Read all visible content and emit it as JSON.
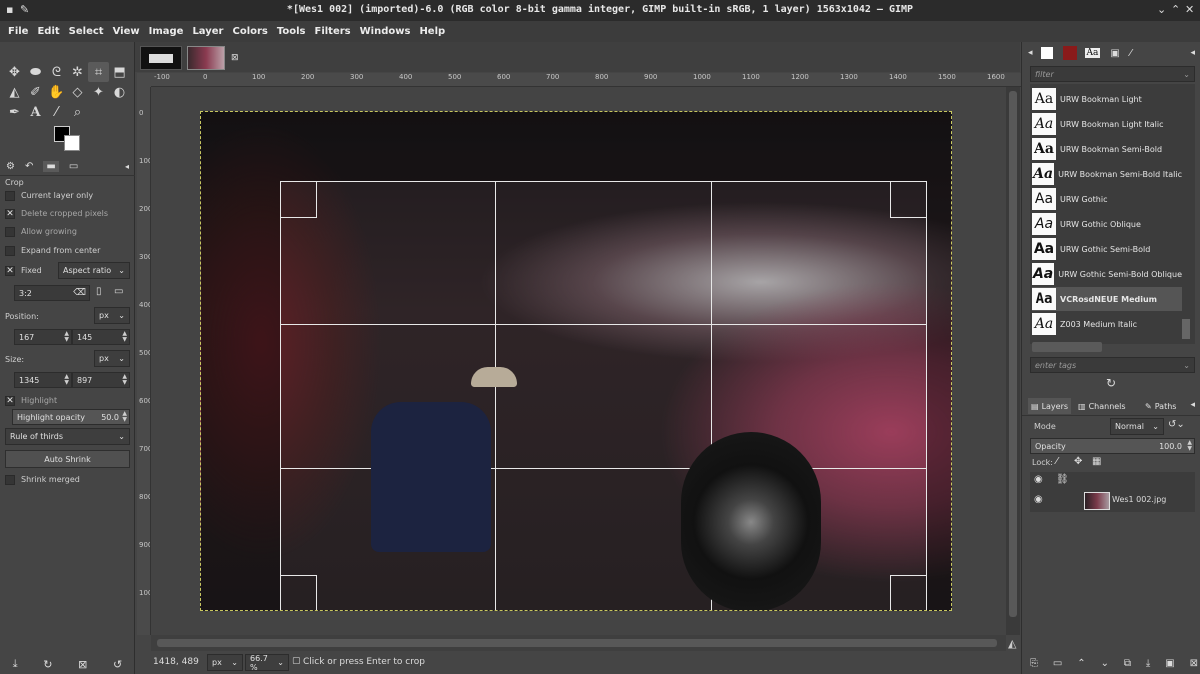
{
  "window": {
    "title": "*[Wes1 002] (imported)-6.0 (RGB color 8-bit gamma integer, GIMP built-in sRGB, 1 layer) 1563x1042 – GIMP",
    "minimize": "⌄",
    "maximize": "⌃",
    "close": "✕"
  },
  "menu": [
    "File",
    "Edit",
    "Select",
    "View",
    "Image",
    "Layer",
    "Colors",
    "Tools",
    "Filters",
    "Windows",
    "Help"
  ],
  "tool_options": {
    "section_title": "Crop",
    "current_layer_only": "Current layer only",
    "delete_cropped": "Delete cropped pixels",
    "allow_growing": "Allow growing",
    "expand_center": "Expand from center",
    "fixed": "Fixed",
    "aspect_ratio": "Aspect ratio",
    "ratio_value": "3:2",
    "position_label": "Position:",
    "position_unit": "px",
    "pos_x": "167",
    "pos_y": "145",
    "size_label": "Size:",
    "size_unit": "px",
    "size_w": "1345",
    "size_h": "897",
    "highlight": "Highlight",
    "highlight_opacity_label": "Highlight opacity",
    "highlight_opacity_value": "50.0",
    "guides": "Rule of thirds",
    "auto_shrink": "Auto Shrink",
    "shrink_merged": "Shrink merged"
  },
  "status": {
    "coords": "1418, 489",
    "unit": "px",
    "zoom": "66.7 %",
    "message": "Click or press Enter to crop"
  },
  "ruler_top": [
    "-100",
    "0",
    "100",
    "200",
    "300",
    "400",
    "500",
    "600",
    "700",
    "800",
    "900",
    "1000",
    "1100",
    "1200",
    "1300",
    "1400",
    "1500",
    "1600"
  ],
  "ruler_left": [
    "0",
    "100",
    "200",
    "300",
    "400",
    "500",
    "600",
    "700",
    "800",
    "900",
    "1000"
  ],
  "fonts": {
    "filter_placeholder": "filter",
    "tags_placeholder": "enter tags",
    "glyph": "Aa",
    "items": [
      "URW Bookman Light",
      "URW Bookman Light Italic",
      "URW Bookman Semi-Bold",
      "URW Bookman Semi-Bold Italic",
      "URW Gothic",
      "URW Gothic Oblique",
      "URW Gothic Semi-Bold",
      "URW Gothic Semi-Bold Oblique",
      "VCRosdNEUE Medium",
      "Z003 Medium Italic"
    ]
  },
  "layers": {
    "tabs": [
      "Layers",
      "Channels",
      "Paths"
    ],
    "mode_label": "Mode",
    "mode_value": "Normal",
    "opacity_label": "Opacity",
    "opacity_value": "100.0",
    "lock_label": "Lock:",
    "layer_name": "Wes1 002.jpg"
  },
  "colors": {
    "accent": "#5a5a5a",
    "guide": "#e8e8e8",
    "selection": "#c8c860"
  }
}
